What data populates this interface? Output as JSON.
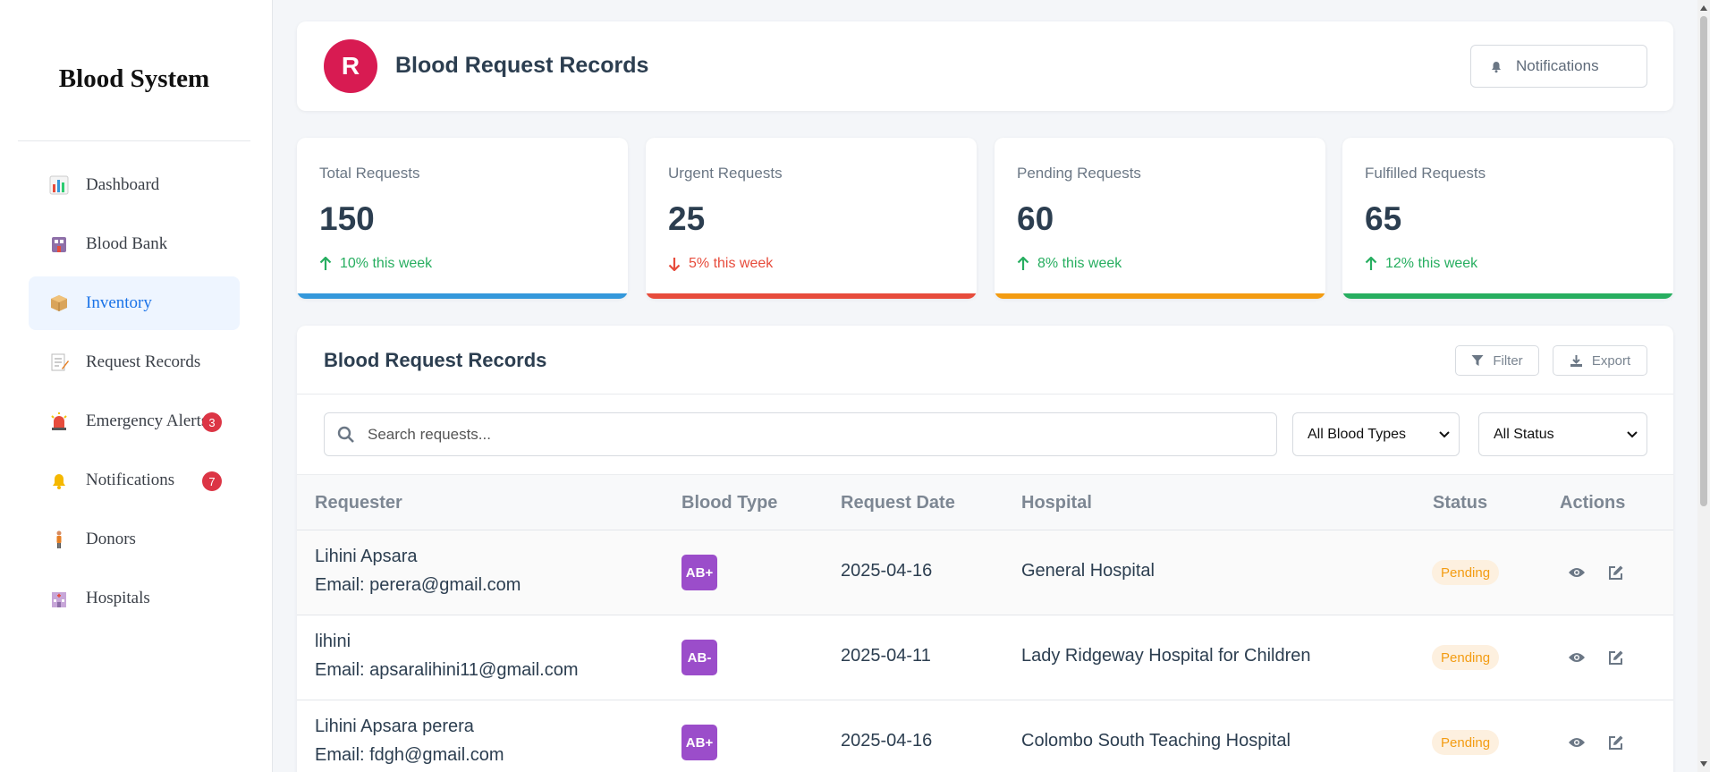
{
  "sidebar": {
    "brand": "Blood System",
    "items": [
      {
        "label": "Dashboard",
        "icon": "chart-icon"
      },
      {
        "label": "Blood Bank",
        "icon": "blood-bank-icon"
      },
      {
        "label": "Inventory",
        "icon": "package-icon",
        "active": true
      },
      {
        "label": "Request Records",
        "icon": "memo-icon"
      },
      {
        "label": "Emergency Alerts",
        "icon": "siren-icon",
        "badge": "3"
      },
      {
        "label": "Notifications",
        "icon": "bell-icon",
        "badge": "7"
      },
      {
        "label": "Donors",
        "icon": "person-icon"
      },
      {
        "label": "Hospitals",
        "icon": "hospital-icon"
      }
    ]
  },
  "header": {
    "avatar_letter": "R",
    "title": "Blood Request Records",
    "notifications_label": "Notifications"
  },
  "stats": [
    {
      "label": "Total Requests",
      "value": "150",
      "trend": "10% this week",
      "direction": "up",
      "trend_color": "#27ae60",
      "bar_color": "#3498db"
    },
    {
      "label": "Urgent Requests",
      "value": "25",
      "trend": "5% this week",
      "direction": "down",
      "trend_color": "#e74c3c",
      "bar_color": "#e74c3c"
    },
    {
      "label": "Pending Requests",
      "value": "60",
      "trend": "8% this week",
      "direction": "up",
      "trend_color": "#27ae60",
      "bar_color": "#f39c12"
    },
    {
      "label": "Fulfilled Requests",
      "value": "65",
      "trend": "12% this week",
      "direction": "up",
      "trend_color": "#27ae60",
      "bar_color": "#27ae60"
    }
  ],
  "records": {
    "title": "Blood Request Records",
    "filter_label": "Filter",
    "export_label": "Export",
    "search_placeholder": "Search requests...",
    "blood_type_filter": "All Blood Types",
    "status_filter": "All Status",
    "columns": [
      "Requester",
      "Blood Type",
      "Request Date",
      "Hospital",
      "Status",
      "Actions"
    ],
    "rows": [
      {
        "name": "Lihini Apsara",
        "email": "Email: perera@gmail.com",
        "blood_type": "AB+",
        "date": "2025-04-16",
        "hospital": "General Hospital",
        "status": "Pending"
      },
      {
        "name": "lihini",
        "email": "Email: apsaralihini11@gmail.com",
        "blood_type": "AB-",
        "date": "2025-04-11",
        "hospital": "Lady Ridgeway Hospital for Children",
        "status": "Pending"
      },
      {
        "name": "Lihini Apsara perera",
        "email": "Email: fdgh@gmail.com",
        "blood_type": "AB+",
        "date": "2025-04-16",
        "hospital": "Colombo South Teaching Hospital",
        "status": "Pending"
      }
    ]
  },
  "colors": {
    "avatar": "#d81b52",
    "active_nav": "#1a73e8",
    "badge": "#dc3545",
    "blood_badge": "#9b4dca",
    "pending": "#f39c12"
  }
}
